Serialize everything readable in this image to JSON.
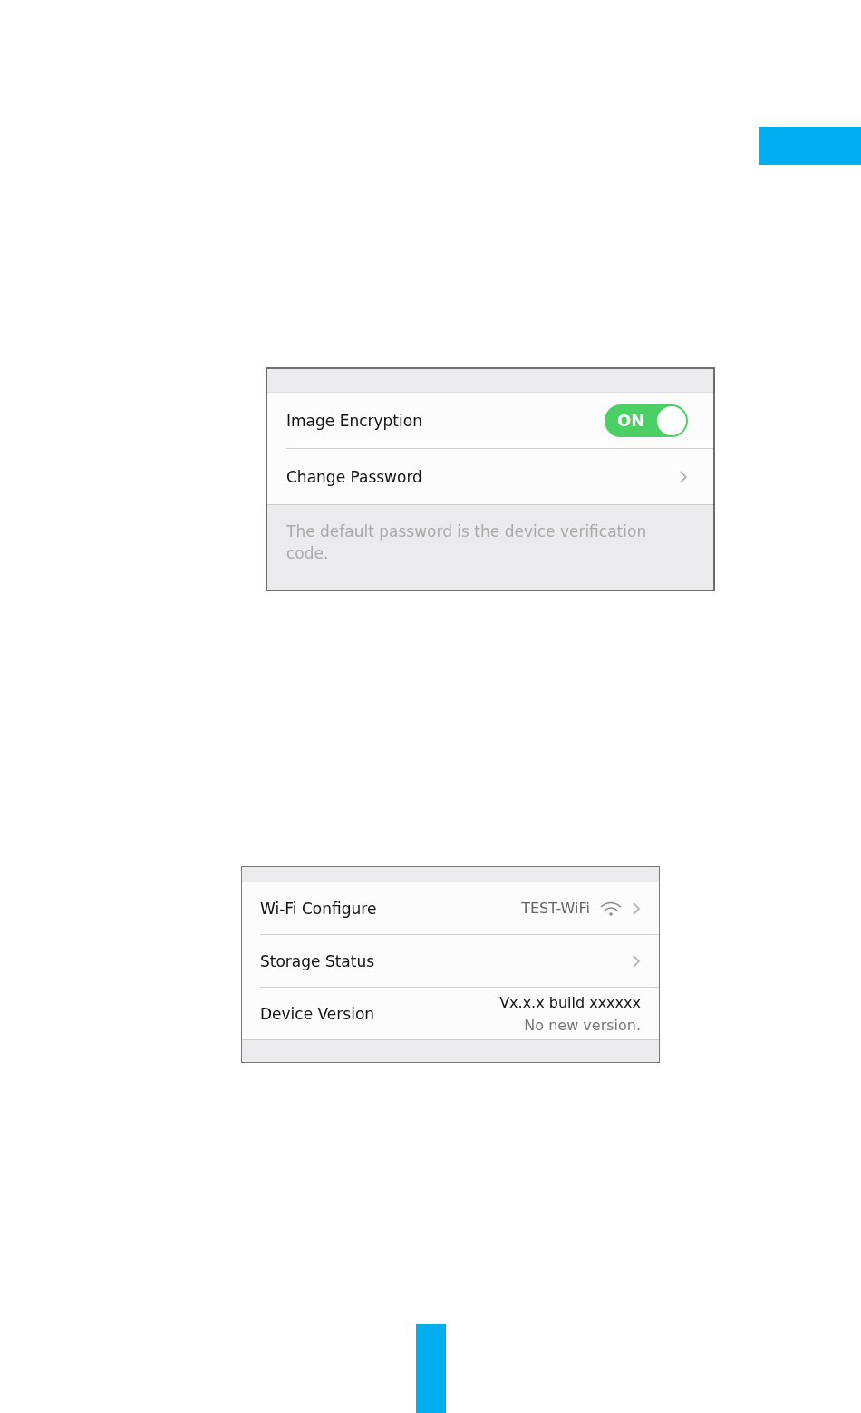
{
  "security_panel": {
    "rows": [
      {
        "kind": "toggle",
        "label": "Image Encryption",
        "switch": {
          "label": "ON",
          "on": true
        }
      },
      {
        "kind": "link",
        "label": "Change Password"
      }
    ],
    "note": "The default password is the device verification code."
  },
  "device_panel": {
    "rows": [
      {
        "kind": "wifi",
        "label": "Wi-Fi Configure",
        "value": "TEST-WiFi"
      },
      {
        "kind": "link",
        "label": "Storage Status"
      },
      {
        "kind": "version",
        "label": "Device Version",
        "value": "Vx.x.x build xxxxxx",
        "note": "No new version."
      }
    ]
  }
}
